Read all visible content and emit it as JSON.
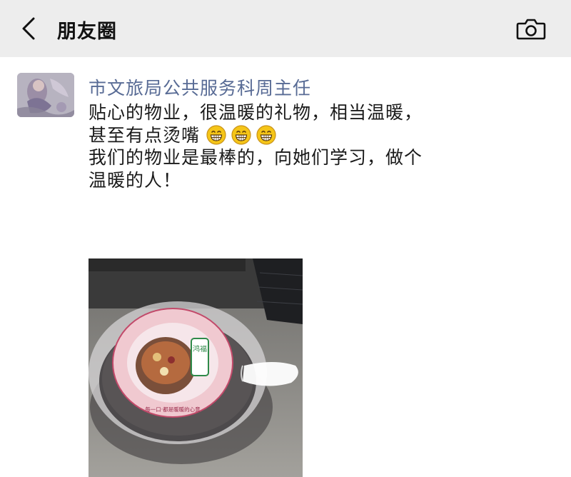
{
  "header": {
    "title": "朋友圈",
    "back_icon": "chevron-left-icon",
    "camera_icon": "camera-icon"
  },
  "post": {
    "author": "市文旅局公共服务科周主任",
    "lines": [
      "贴心的物业，很温暖的礼物，相当温暖，",
      "甚至有点烫嘴",
      "我们的物业是最棒的，向她们学习，做个",
      "温暖的人！"
    ],
    "emoji": [
      "grinning-face-emoji",
      "grinning-face-emoji",
      "grinning-face-emoji"
    ],
    "photo": {
      "lid_brand": "鸿福",
      "lid_text": "每一口·都是暖暖的心意"
    }
  },
  "colors": {
    "header_bg": "#ededed",
    "author_name": "#586b95",
    "body_text": "#1a1a1a"
  }
}
